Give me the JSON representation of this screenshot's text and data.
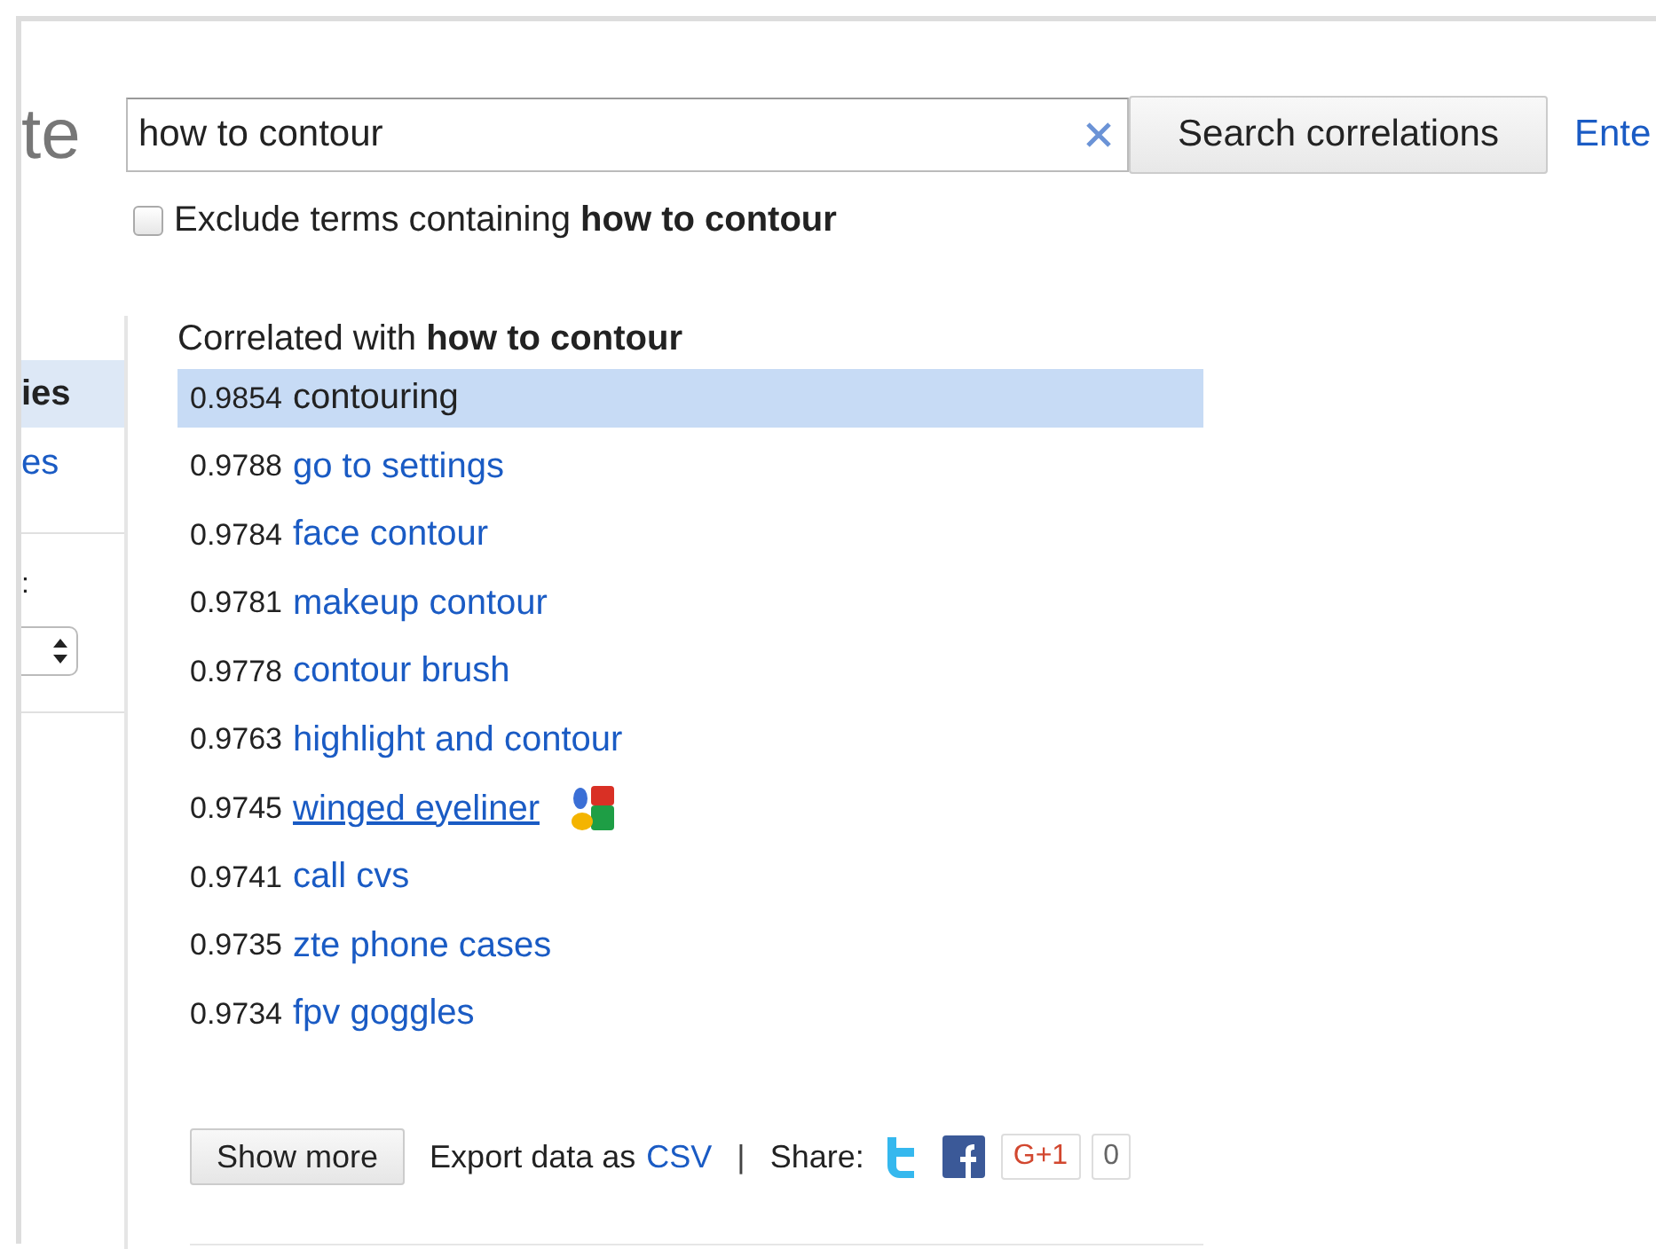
{
  "header": {
    "logo": "te",
    "search": {
      "value": "how to contour"
    },
    "search_button": "Search correlations",
    "link": "Ente"
  },
  "exclude": {
    "checked": false,
    "text": "Exclude terms containing **how to contour**"
  },
  "sidebar": {
    "items": [
      {
        "label": "ies",
        "selected": true
      },
      {
        "label": "es",
        "selected": false
      }
    ],
    "label": ":"
  },
  "results": {
    "heading": "Correlated with **how to contour**",
    "rows": [
      {
        "score": "0.9854",
        "term": "contouring",
        "selected": true,
        "hovered": false,
        "preview_icon": false
      },
      {
        "score": "0.9788",
        "term": "go to settings",
        "selected": false,
        "hovered": false,
        "preview_icon": false
      },
      {
        "score": "0.9784",
        "term": "face contour",
        "selected": false,
        "hovered": false,
        "preview_icon": false
      },
      {
        "score": "0.9781",
        "term": "makeup contour",
        "selected": false,
        "hovered": false,
        "preview_icon": false
      },
      {
        "score": "0.9778",
        "term": "contour brush",
        "selected": false,
        "hovered": false,
        "preview_icon": false
      },
      {
        "score": "0.9763",
        "term": "highlight and contour",
        "selected": false,
        "hovered": false,
        "preview_icon": false
      },
      {
        "score": "0.9745",
        "term": "winged eyeliner",
        "selected": false,
        "hovered": true,
        "preview_icon": true
      },
      {
        "score": "0.9741",
        "term": "call cvs",
        "selected": false,
        "hovered": false,
        "preview_icon": false
      },
      {
        "score": "0.9735",
        "term": "zte phone cases",
        "selected": false,
        "hovered": false,
        "preview_icon": false
      },
      {
        "score": "0.9734",
        "term": "fpv goggles",
        "selected": false,
        "hovered": false,
        "preview_icon": false
      }
    ]
  },
  "footer": {
    "show_more": "Show more",
    "export_text": "Export data as",
    "export_link": "CSV",
    "separator": "|",
    "share": "Share:",
    "plus_button": "G+1",
    "plus_count": "0"
  }
}
